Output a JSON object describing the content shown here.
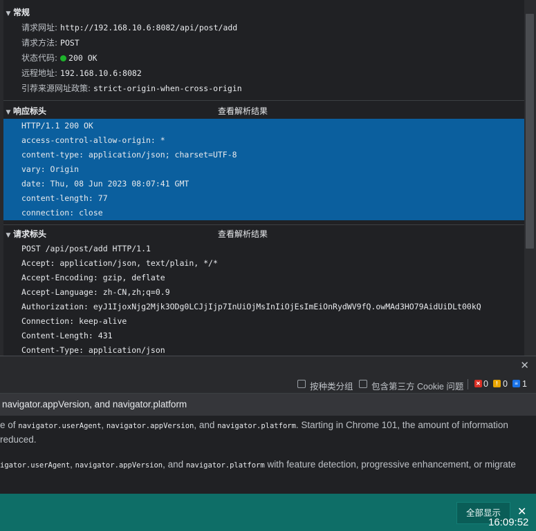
{
  "general": {
    "title": "常规",
    "rows": [
      {
        "key": "请求网址:",
        "value": "http://192.168.10.6:8082/api/post/add"
      },
      {
        "key": "请求方法:",
        "value": "POST"
      },
      {
        "key": "状态代码:",
        "value": "200 OK"
      },
      {
        "key": "远程地址:",
        "value": "192.168.10.6:8082"
      },
      {
        "key": "引荐来源网址政策:",
        "value": "strict-origin-when-cross-origin"
      }
    ]
  },
  "response_headers": {
    "title": "响应标头",
    "link": "查看解析结果",
    "lines": [
      "HTTP/1.1 200 OK",
      "access-control-allow-origin: *",
      "content-type: application/json; charset=UTF-8",
      "vary: Origin",
      "date: Thu, 08 Jun 2023 08:07:41 GMT",
      "content-length: 77",
      "connection: close"
    ]
  },
  "request_headers": {
    "title": "请求标头",
    "link": "查看解析结果",
    "lines": [
      "POST /api/post/add HTTP/1.1",
      "Accept: application/json, text/plain, */*",
      "Accept-Encoding: gzip, deflate",
      "Accept-Language: zh-CN,zh;q=0.9",
      "Authorization: eyJ1IjoxNjg2Mjk3ODg0LCJjIjp7InUiOjMsInIiOjEsImEiOnRydWV9fQ.owMAd3HO79AidUiDLt00kQ",
      "Connection: keep-alive",
      "Content-Length: 431",
      "Content-Type: application/json"
    ]
  },
  "issues": {
    "close_glyph": "✕",
    "group_label": "按种类分组",
    "thirdparty_label": "包含第三方 Cookie 问题",
    "error_count": "0",
    "warning_count": "0",
    "info_count": "1",
    "issue_title": "navigator.appVersion, and navigator.platform",
    "line1_pre": "e of ",
    "line1_c1": "navigator.userAgent",
    "line1_s1": ", ",
    "line1_c2": "navigator.appVersion",
    "line1_s2": ", and ",
    "line1_c3": "navigator.platform",
    "line1_post": ". Starting in Chrome 101, the amount of information",
    "line2": " reduced.",
    "line3_c1": "igator.userAgent",
    "line3_s1": ", ",
    "line3_c2": "navigator.appVersion",
    "line3_s2": ", and ",
    "line3_c3": "navigator.platform",
    "line3_post": " with feature detection, progressive enhancement, or migrate"
  },
  "taskbar": {
    "show_all": "全部显示",
    "close_glyph": "✕",
    "time": "16:09:52"
  },
  "colors": {
    "selection": "#0b5f9e",
    "status_ok": "#1db32b",
    "taskbar": "#0e6e67"
  }
}
